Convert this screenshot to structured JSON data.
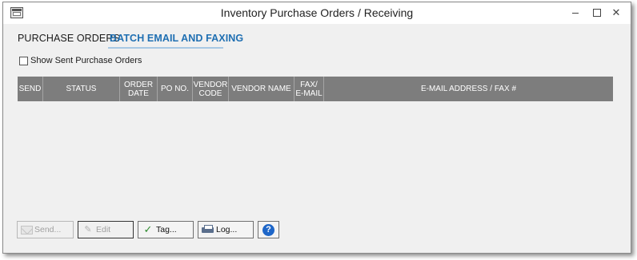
{
  "window": {
    "title": "Inventory Purchase Orders / Receiving",
    "controls": {
      "minimize": "",
      "maximize": "",
      "close": "✕"
    }
  },
  "tabs": [
    {
      "label": "PURCHASE ORDERS",
      "active": false
    },
    {
      "label": "BATCH EMAIL AND FAXING",
      "active": true
    }
  ],
  "filters": {
    "show_sent": {
      "label": "Show Sent Purchase Orders",
      "checked": false
    }
  },
  "grid": {
    "columns": [
      "SEND",
      "STATUS",
      "ORDER\nDATE",
      "PO NO.",
      "VENDOR\nCODE",
      "VENDOR NAME",
      "FAX/\nE-MAIL",
      "E-MAIL ADDRESS / FAX #"
    ],
    "rows": []
  },
  "buttons": {
    "send": {
      "label": "Send...",
      "enabled": false,
      "icon": "envelope-icon"
    },
    "edit": {
      "label": "Edit",
      "enabled": false,
      "icon": "pencil-icon"
    },
    "tag": {
      "label": "Tag...",
      "enabled": true,
      "icon": "checkmark-icon"
    },
    "log": {
      "label": "Log...",
      "enabled": true,
      "icon": "printer-icon"
    },
    "help": {
      "label": "?",
      "enabled": true,
      "icon": "help-icon"
    }
  },
  "colors": {
    "accent": "#1f6fb2",
    "grid_header": "#7d7d7d",
    "help_blue": "#1e66c8"
  }
}
